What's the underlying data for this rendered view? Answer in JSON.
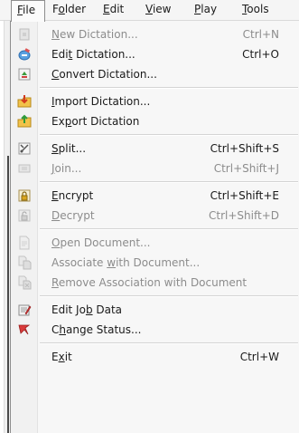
{
  "menubar": {
    "items": [
      {
        "pre": "",
        "key": "F",
        "post": "ile"
      },
      {
        "pre": "F",
        "key": "o",
        "post": "lder"
      },
      {
        "pre": "",
        "key": "E",
        "post": "dit"
      },
      {
        "pre": "",
        "key": "V",
        "post": "iew"
      },
      {
        "pre": "",
        "key": "P",
        "post": "lay"
      },
      {
        "pre": "",
        "key": "T",
        "post": "ools"
      }
    ]
  },
  "file_menu": {
    "items": [
      {
        "pre": "",
        "key": "N",
        "post": "ew Dictation...",
        "shortcut": "Ctrl+N",
        "icon": "new-dictation-icon",
        "enabled": false
      },
      {
        "pre": "Edi",
        "key": "t",
        "post": " Dictation...",
        "shortcut": "Ctrl+O",
        "icon": "edit-dictation-icon",
        "enabled": true
      },
      {
        "pre": "",
        "key": "C",
        "post": "onvert Dictation...",
        "shortcut": "",
        "icon": "convert-dictation-icon",
        "enabled": true
      },
      {
        "pre": "",
        "key": "I",
        "post": "mport Dictation...",
        "shortcut": "",
        "icon": "import-dictation-icon",
        "enabled": true
      },
      {
        "pre": "Ex",
        "key": "p",
        "post": "ort Dictation",
        "shortcut": "",
        "icon": "export-dictation-icon",
        "enabled": true
      },
      {
        "pre": "",
        "key": "S",
        "post": "plit...",
        "shortcut": "Ctrl+Shift+S",
        "icon": "split-icon",
        "enabled": true
      },
      {
        "pre": "",
        "key": "J",
        "post": "oin...",
        "shortcut": "Ctrl+Shift+J",
        "icon": "join-icon",
        "enabled": false
      },
      {
        "pre": "",
        "key": "E",
        "post": "ncrypt",
        "shortcut": "Ctrl+Shift+E",
        "icon": "encrypt-icon",
        "enabled": true
      },
      {
        "pre": "",
        "key": "D",
        "post": "ecrypt",
        "shortcut": "Ctrl+Shift+D",
        "icon": "decrypt-icon",
        "enabled": false
      },
      {
        "pre": "",
        "key": "O",
        "post": "pen Document...",
        "shortcut": "",
        "icon": "open-document-icon",
        "enabled": false
      },
      {
        "pre": "Associate ",
        "key": "w",
        "post": "ith Document...",
        "shortcut": "",
        "icon": "associate-document-icon",
        "enabled": false
      },
      {
        "pre": "",
        "key": "R",
        "post": "emove Association with Document",
        "shortcut": "",
        "icon": "remove-association-icon",
        "enabled": false
      },
      {
        "pre": "Edit Jo",
        "key": "b",
        "post": " Data",
        "shortcut": "",
        "icon": "job-data-icon",
        "enabled": true
      },
      {
        "pre": "C",
        "key": "h",
        "post": "ange Status...",
        "shortcut": "",
        "icon": "change-status-icon",
        "enabled": true
      },
      {
        "pre": "E",
        "key": "x",
        "post": "it",
        "shortcut": "Ctrl+W",
        "icon": "",
        "enabled": true
      }
    ]
  }
}
